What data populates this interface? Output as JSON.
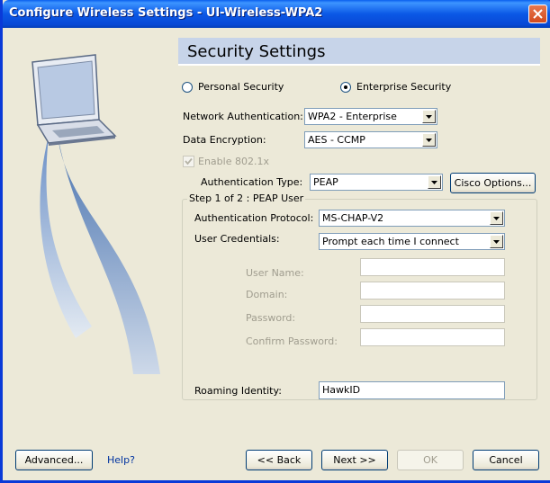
{
  "window": {
    "title": "Configure Wireless Settings - UI-Wireless-WPA2"
  },
  "header": {
    "title": "Security Settings"
  },
  "security_mode": {
    "personal_label": "Personal Security",
    "enterprise_label": "Enterprise Security",
    "selected": "Enterprise Security"
  },
  "network_auth": {
    "label": "Network Authentication:",
    "value": "WPA2 - Enterprise"
  },
  "data_encryption": {
    "label": "Data Encryption:",
    "value": "AES - CCMP"
  },
  "enable_8021x": {
    "label": "Enable 802.1x",
    "checked": true
  },
  "auth_type": {
    "label": "Authentication Type:",
    "value": "PEAP",
    "options_button": "Cisco Options..."
  },
  "peap": {
    "group_label": "Step 1 of 2 : PEAP User",
    "auth_protocol": {
      "label": "Authentication Protocol:",
      "value": "MS-CHAP-V2"
    },
    "user_credentials": {
      "label": "User Credentials:",
      "value": "Prompt each time I connect"
    },
    "user_name": {
      "label": "User Name:",
      "value": ""
    },
    "domain": {
      "label": "Domain:",
      "value": ""
    },
    "password": {
      "label": "Password:",
      "value": ""
    },
    "confirm_password": {
      "label": "Confirm Password:",
      "value": ""
    },
    "roaming_identity": {
      "label": "Roaming Identity:",
      "value": "HawkID"
    }
  },
  "footer": {
    "advanced": "Advanced...",
    "help": "Help?",
    "back": "<< Back",
    "next": "Next >>",
    "ok": "OK",
    "cancel": "Cancel"
  },
  "colors": {
    "titlebar": "#0b58e6",
    "header_band": "#c7d4e9",
    "dialog_bg": "#ece9d8",
    "close_button": "#d44a1d"
  },
  "icons": [
    "close-icon",
    "laptop-icon",
    "dropdown-arrow-icon",
    "checkmark-icon"
  ]
}
